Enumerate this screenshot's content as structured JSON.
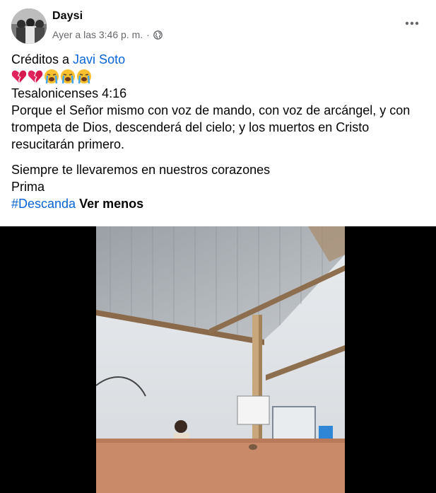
{
  "post": {
    "author": "Daysi",
    "timestamp": "Ayer a las 3:46 p. m.",
    "separator": "·",
    "privacy_icon": "globe-icon",
    "more_icon": "more-options-icon"
  },
  "content": {
    "credits_prefix": "Créditos a ",
    "credits_name": "Javi Soto",
    "emojis": [
      "broken-heart",
      "broken-heart",
      "loudly-crying-face",
      "loudly-crying-face",
      "loudly-crying-face"
    ],
    "verse_ref": "Tesalonicenses 4:16",
    "verse_text": "Porque el Señor mismo con voz de mando, con voz de arcángel, y con trompeta de Dios, descenderá del cielo; y los muertos en Cristo resucitarán primero.",
    "line_1": "Siempre te llevaremos en nuestros corazones",
    "line_2": "Prima",
    "hashtag": "#Descanda",
    "see_less": "Ver menos"
  },
  "media": {
    "type": "video",
    "description_icon": "video-frame"
  },
  "colors": {
    "link": "#0864d6",
    "meta_gray": "#65676b",
    "text": "#050505"
  }
}
